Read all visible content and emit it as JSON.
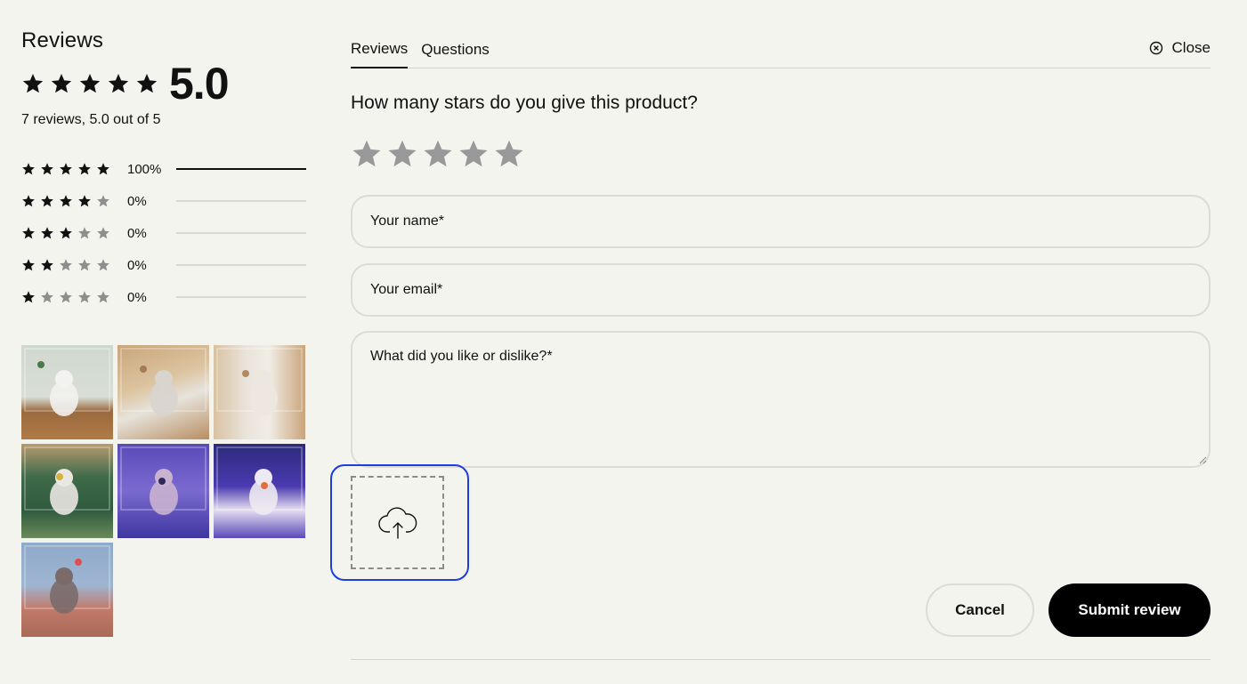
{
  "summary_panel": {
    "title": "Reviews",
    "average": "5.0",
    "average_stars": 5,
    "summary_text": "7 reviews, 5.0 out of 5",
    "distribution": [
      {
        "stars": 5,
        "percent_label": "100%",
        "fraction": 1.0
      },
      {
        "stars": 4,
        "percent_label": "0%",
        "fraction": 0
      },
      {
        "stars": 3,
        "percent_label": "0%",
        "fraction": 0
      },
      {
        "stars": 2,
        "percent_label": "0%",
        "fraction": 0
      },
      {
        "stars": 1,
        "percent_label": "0%",
        "fraction": 0
      }
    ],
    "photo_count": 7
  },
  "tabs": [
    {
      "label": "Reviews",
      "active": true
    },
    {
      "label": "Questions",
      "active": false
    }
  ],
  "close_label": "Close",
  "form": {
    "question": "How many stars do you give this product?",
    "selected_rating": 0,
    "name_placeholder": "Your name*",
    "email_placeholder": "Your email*",
    "comment_placeholder": "What did you like or dislike?*",
    "upload_icon": "cloud-upload-icon",
    "cancel_label": "Cancel",
    "submit_label": "Submit review"
  },
  "colors": {
    "background": "#f4f4ef",
    "star_filled": "#111111",
    "star_empty": "#8e8e8e",
    "rating_star": "#999999",
    "focus_ring": "#1d3de0",
    "submit_bg": "#000000"
  }
}
